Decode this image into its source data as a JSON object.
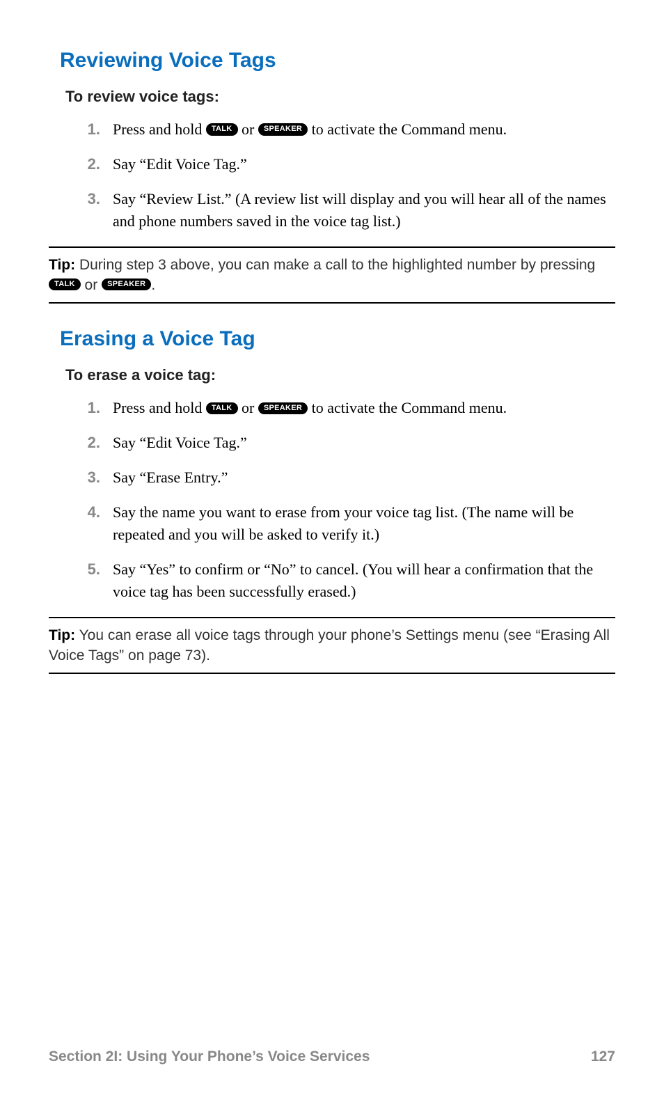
{
  "buttons": {
    "talk": "TALK",
    "speaker": "SPEAKER"
  },
  "section1": {
    "heading": "Reviewing Voice Tags",
    "subheading": "To review voice tags:",
    "steps": {
      "s1a": "Press and hold ",
      "s1b": " or ",
      "s1c": " to activate the Command menu.",
      "s2": "Say “Edit Voice Tag.”",
      "s3": "Say “Review List.” (A review list will display and you will hear all of the names and phone numbers saved in the voice tag list.)"
    },
    "tip": {
      "label": "Tip:",
      "t1": " During step 3 above, you can make a call to the highlighted number by pressing ",
      "t2": " or ",
      "t3": "."
    }
  },
  "section2": {
    "heading": "Erasing a Voice Tag",
    "subheading": "To erase a voice tag:",
    "steps": {
      "s1a": "Press and hold ",
      "s1b": " or ",
      "s1c": " to activate the Command menu.",
      "s2": "Say “Edit Voice Tag.”",
      "s3": "Say “Erase Entry.”",
      "s4": "Say the name you want to erase from your voice tag list. (The name will be repeated and you will be asked to verify it.)",
      "s5": "Say “Yes” to confirm or “No” to cancel. (You will hear a confirmation that the voice tag has been successfully erased.)"
    },
    "tip": {
      "label": "Tip:",
      "text": " You can erase all voice tags through your phone’s Settings menu (see “Erasing All Voice Tags” on page 73)."
    }
  },
  "footer": {
    "section": "Section 2I: Using Your Phone’s Voice Services",
    "page": "127"
  }
}
